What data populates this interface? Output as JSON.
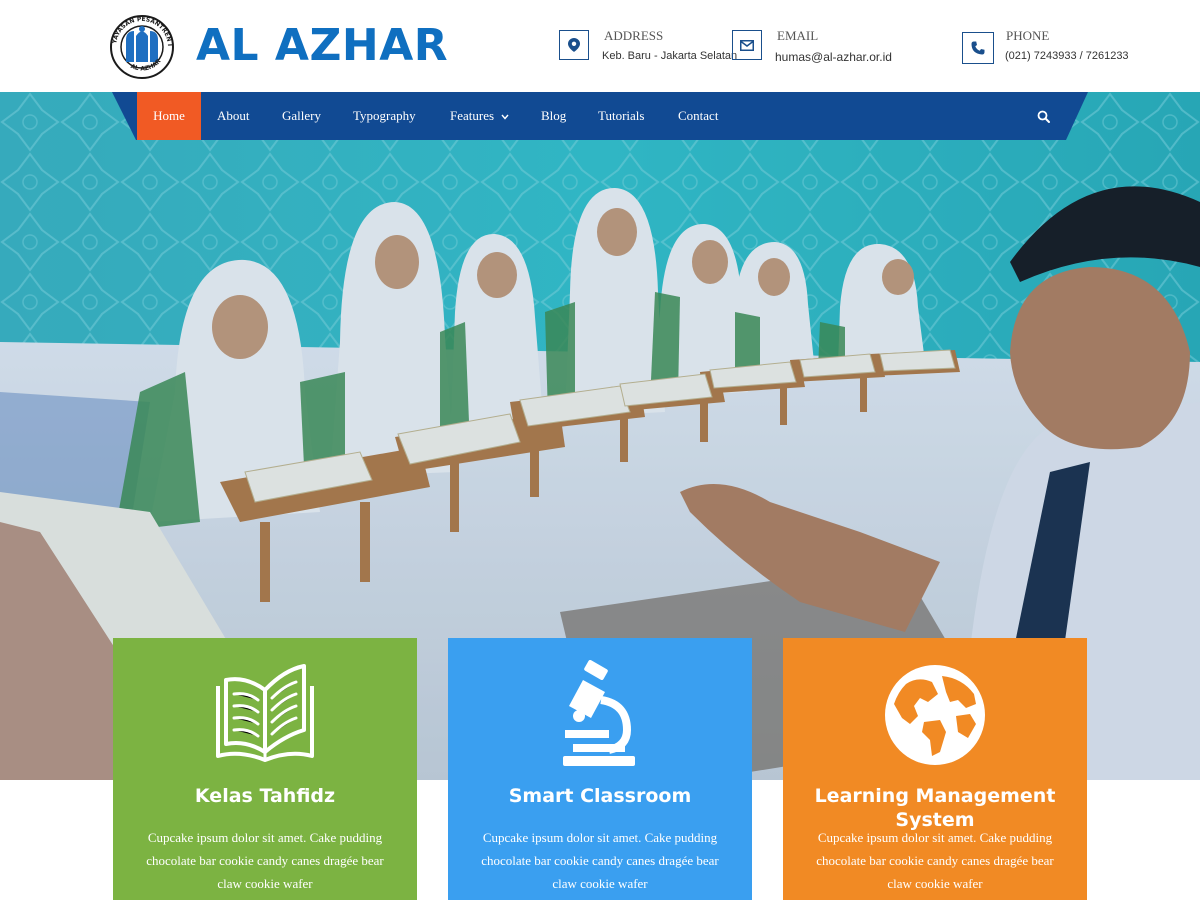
{
  "header": {
    "brand": "AL AZHAR",
    "emblem_text_top": "YAYASAN PESANTREN ISLAM",
    "emblem_text_bottom": "AL AZHAR",
    "contacts": [
      {
        "icon": "map-marker-icon",
        "title": "ADDRESS",
        "value": "Keb. Baru - Jakarta Selatan"
      },
      {
        "icon": "envelope-icon",
        "title": "EMAIL",
        "value": "humas@al-azhar.or.id"
      },
      {
        "icon": "phone-icon",
        "title": "PHONE",
        "value": "(021) 7243933 / 7261233"
      }
    ]
  },
  "nav": {
    "items": [
      "Home",
      "About",
      "Gallery",
      "Typography",
      "Features",
      "Blog",
      "Tutorials",
      "Contact"
    ],
    "active": "Home",
    "search_icon": "search-icon"
  },
  "features": [
    {
      "title": "Kelas Tahfidz",
      "icon": "open-book-icon",
      "color": "#7cb342",
      "text": "Cupcake ipsum dolor sit amet. Cake pudding chocolate bar cookie candy canes dragée bear claw cookie wafer"
    },
    {
      "title": "Smart Classroom",
      "icon": "microscope-icon",
      "color": "#3a9ff0",
      "text": "Cupcake ipsum dolor sit amet. Cake pudding chocolate bar cookie candy canes dragée bear claw cookie wafer"
    },
    {
      "title": "Learning Management System",
      "icon": "globe-icon",
      "color": "#f18a24",
      "text": "Cupcake ipsum dolor sit amet. Cake pudding chocolate bar cookie candy canes dragée bear claw cookie wafer"
    }
  ],
  "colors": {
    "brand_blue": "#0f6fc0",
    "nav_blue": "#114a93",
    "active_orange": "#f15a24"
  }
}
